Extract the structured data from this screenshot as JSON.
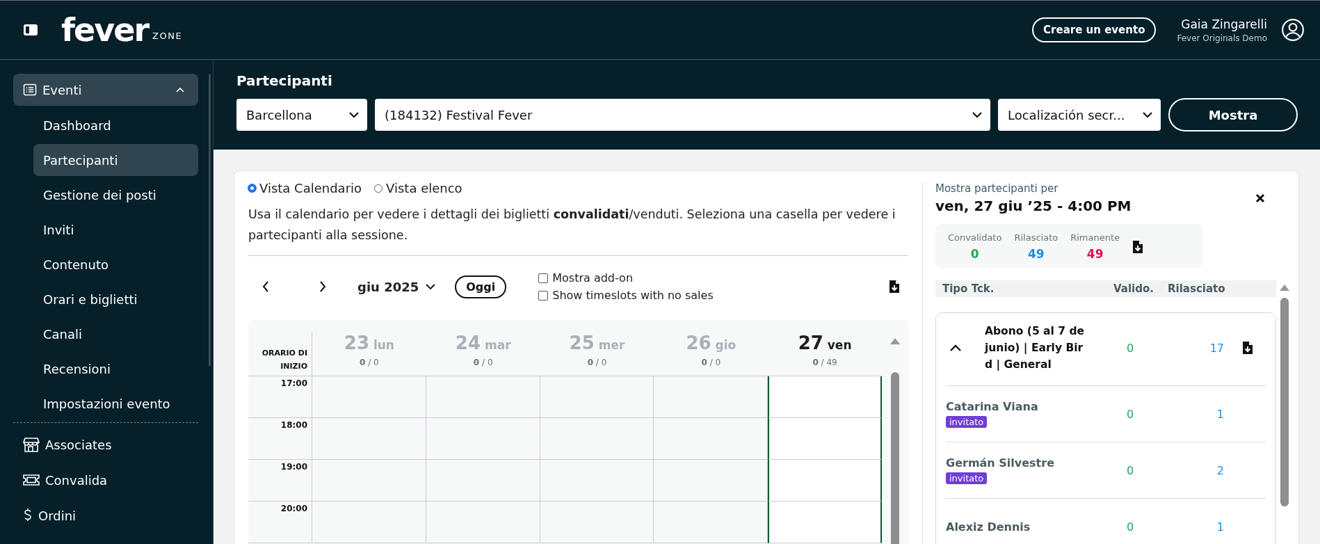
{
  "header": {
    "logo": "fever",
    "logo_sub": "ZONE",
    "create_button": "Creare un evento",
    "user_name": "Gaia Zingarelli",
    "user_org": "Fever Originals Demo"
  },
  "sidebar": {
    "items": [
      {
        "label": "Eventi",
        "kind": "list",
        "selected": true,
        "expanded": true,
        "children": [
          {
            "label": "Dashboard",
            "selected": false
          },
          {
            "label": "Partecipanti",
            "selected": true
          },
          {
            "label": "Gestione dei posti",
            "selected": false
          },
          {
            "label": "Inviti",
            "selected": false
          },
          {
            "label": "Contenuto",
            "selected": false
          },
          {
            "label": "Orari e biglietti",
            "selected": false
          },
          {
            "label": "Canali",
            "selected": false
          },
          {
            "label": "Recensioni",
            "selected": false
          },
          {
            "label": "Impostazioni evento",
            "selected": false
          }
        ]
      },
      {
        "label": "Associates",
        "kind": "store",
        "selected": false
      },
      {
        "label": "Convalida",
        "kind": "ticket",
        "selected": false
      },
      {
        "label": "Ordini",
        "kind": "dollar",
        "selected": false
      }
    ]
  },
  "filters": {
    "title": "Partecipanti",
    "selects": [
      {
        "value": "Barcellona"
      },
      {
        "value": "(184132) Festival Fever"
      },
      {
        "value": "Localización secr..."
      }
    ],
    "button": "Mostra"
  },
  "views": [
    {
      "label": "Vista Calendario",
      "selected": true
    },
    {
      "label": "Vista elenco",
      "selected": false
    }
  ],
  "description": "Usa il calendario per vedere i dettagli dei biglietti **convalidati**/venduti. Seleziona una casella per vedere i partecipanti alla sessione.",
  "calendar": {
    "month": "giu 2025",
    "today_button": "Oggi",
    "toggles": [
      {
        "label": "Mostra add-on",
        "checked": false
      },
      {
        "label": "Show timeslots with no sales",
        "checked": false
      }
    ],
    "time_header": "ORARIO DI INIZIO",
    "days": [
      {
        "day": "23",
        "weekday": "lun",
        "count": "**0** / 0",
        "selected": false
      },
      {
        "day": "24",
        "weekday": "mar",
        "count": "**0** / 0",
        "selected": false
      },
      {
        "day": "25",
        "weekday": "mer",
        "count": "**0** / 0",
        "selected": false
      },
      {
        "day": "26",
        "weekday": "gio",
        "count": "**0** / 0",
        "selected": false
      },
      {
        "day": "27",
        "weekday": "ven",
        "count": "**0** / 49",
        "selected": true
      }
    ],
    "times": [
      "17:00",
      "18:00",
      "19:00",
      "20:00"
    ]
  },
  "details": {
    "label": "Mostra partecipanti per",
    "title": "ven, 27 giu ’25 - 4:00 PM",
    "stats": [
      {
        "label": "Convalidato",
        "value": "0",
        "color": "#1fa55a"
      },
      {
        "label": "Rilasciato",
        "value": "49",
        "color": "#1a8fe3"
      },
      {
        "label": "Rimanente",
        "value": "49",
        "color": "#e0104f"
      }
    ],
    "columns": [
      "Tipo Tck.",
      "Valido.",
      "Rilasciato"
    ],
    "groups": [
      {
        "name": "Abono (5 al 7 de junio) | Early Bird | General",
        "expanded": true,
        "validated": "0",
        "released": "17",
        "attendees": [
          {
            "name": "Catarina Viana",
            "tag": "invitato",
            "validated": "0",
            "released": "1"
          },
          {
            "name": "Germán Silvestre",
            "tag": "invitato",
            "validated": "0",
            "released": "2"
          },
          {
            "name": "Alexiz Dennis",
            "validated": "0",
            "released": "1"
          }
        ]
      }
    ]
  }
}
